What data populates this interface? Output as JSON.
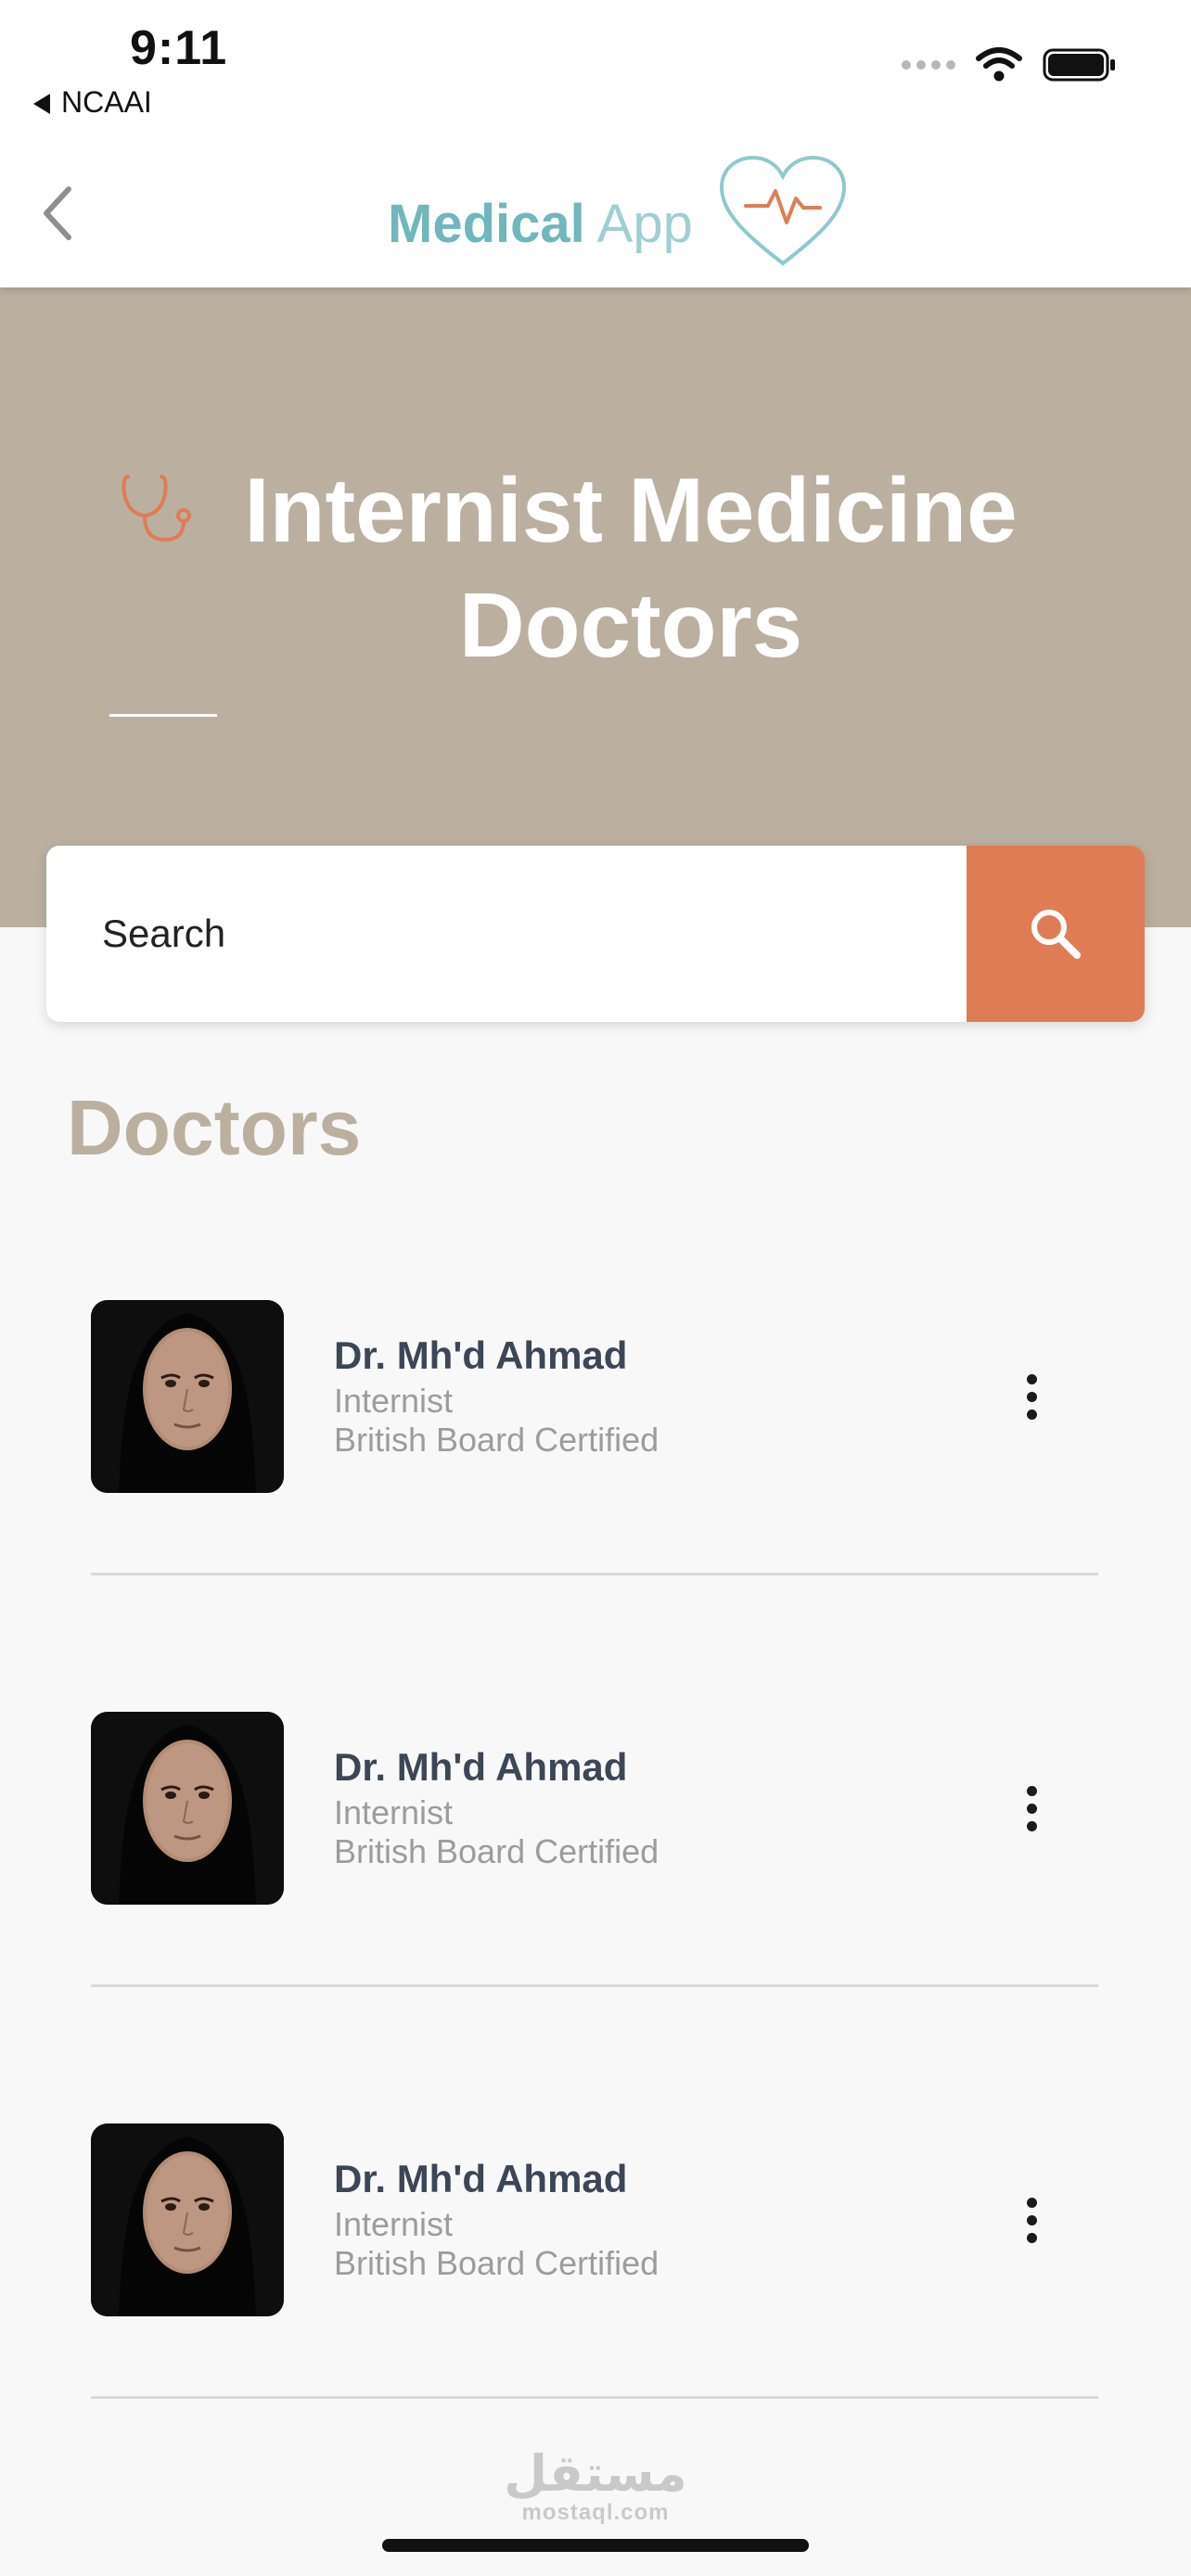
{
  "status_bar": {
    "time": "9:11",
    "back_app": "NCAAI"
  },
  "nav": {
    "brand_word1": "Medical",
    "brand_word2": " App",
    "back_icon": "chevron-left-icon"
  },
  "hero": {
    "icon": "stethoscope-icon",
    "title": "Internist Medicine Doctors"
  },
  "search": {
    "placeholder": "Search",
    "button_icon": "search-icon"
  },
  "section_title": "Doctors",
  "doctors": [
    {
      "name": "Dr. Mh'd Ahmad",
      "specialty": "Internist",
      "certification": "British Board Certified"
    },
    {
      "name": "Dr. Mh'd Ahmad",
      "specialty": "Internist",
      "certification": "British Board Certified"
    },
    {
      "name": "Dr. Mh'd Ahmad",
      "specialty": "Internist",
      "certification": "British Board Certified"
    }
  ],
  "watermark": {
    "arabic": "مستقل",
    "latin": "mostaql.com"
  },
  "colors": {
    "accent": "#de7d55",
    "hero_bg": "#bbb0a0",
    "brand_teal": "#6fb7bd",
    "name_text": "#3b4656"
  }
}
